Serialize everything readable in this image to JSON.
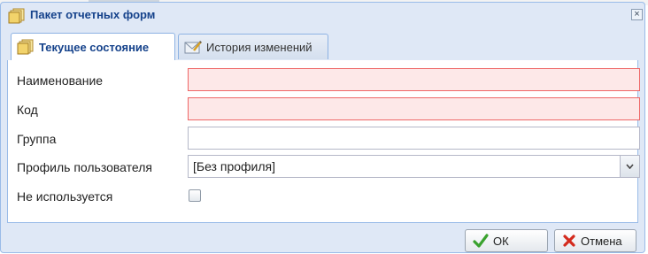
{
  "window": {
    "title": "Пакет отчетных форм",
    "title_icon": "folder-icon",
    "close_label": "×"
  },
  "tabs": [
    {
      "label": "Текущее состояние",
      "icon": "folder-icon",
      "active": true
    },
    {
      "label": "История изменений",
      "icon": "mail-edit-icon",
      "active": false
    }
  ],
  "form": {
    "name": {
      "label": "Наименование",
      "value": "",
      "invalid": true
    },
    "code": {
      "label": "Код",
      "value": "",
      "invalid": true
    },
    "group": {
      "label": "Группа",
      "value": ""
    },
    "profile": {
      "label": "Профиль пользователя",
      "value": "[Без профиля]"
    },
    "unused": {
      "label": "Не используется",
      "checked": false
    }
  },
  "buttons": {
    "ok_label": "ОК",
    "cancel_label": "Отмена"
  },
  "colors": {
    "window_bg": "#dfe8f6",
    "border": "#99bbe8",
    "title_text": "#15428b",
    "invalid_bg": "#fde8e8",
    "invalid_border": "#e66",
    "ok_icon": "#3aa22e",
    "cancel_icon": "#d42b1e"
  }
}
